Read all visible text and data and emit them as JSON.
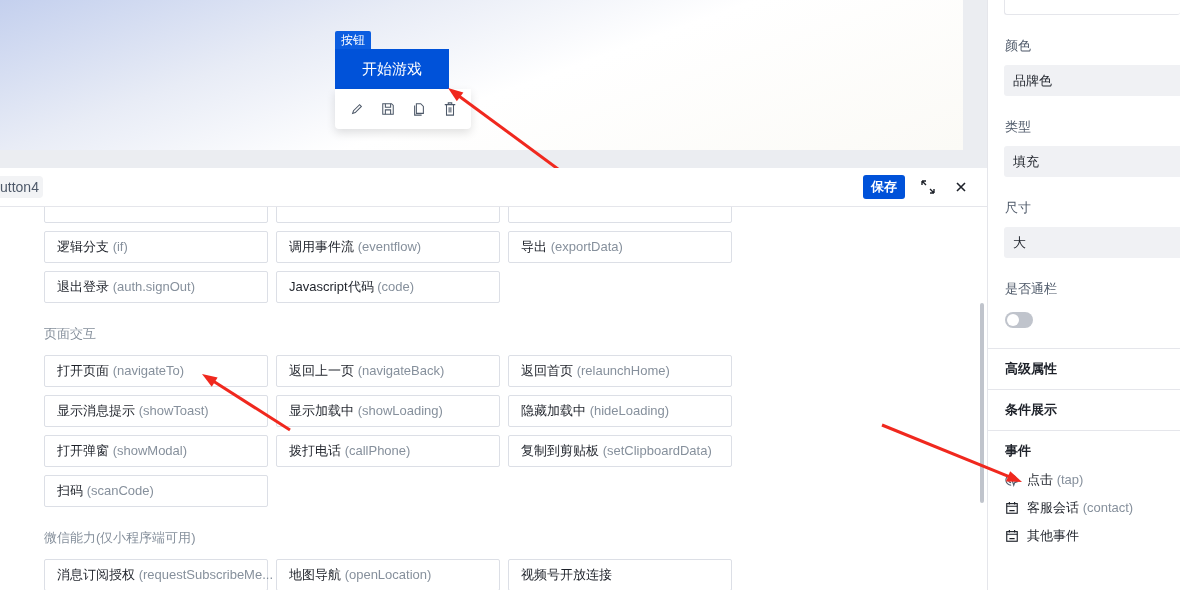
{
  "canvas": {
    "component_tag": "按钮",
    "button_label": "开始游戏"
  },
  "editor": {
    "tag": "utton4",
    "save": "保存",
    "groups": [
      {
        "actions": [
          {
            "name": "逻辑分支",
            "api": "(if)"
          },
          {
            "name": "调用事件流",
            "api": "(eventflow)"
          },
          {
            "name": "导出",
            "api": "(exportData)"
          },
          {
            "name": "退出登录",
            "api": "(auth.signOut)"
          },
          {
            "name": "Javascript代码",
            "api": "(code)"
          }
        ]
      },
      {
        "title": "页面交互",
        "actions": [
          {
            "name": "打开页面",
            "api": "(navigateTo)"
          },
          {
            "name": "返回上一页",
            "api": "(navigateBack)"
          },
          {
            "name": "返回首页",
            "api": "(relaunchHome)"
          },
          {
            "name": "显示消息提示",
            "api": "(showToast)"
          },
          {
            "name": "显示加载中",
            "api": "(showLoading)"
          },
          {
            "name": "隐藏加载中",
            "api": "(hideLoading)"
          },
          {
            "name": "打开弹窗",
            "api": "(showModal)"
          },
          {
            "name": "拨打电话",
            "api": "(callPhone)"
          },
          {
            "name": "复制到剪贴板",
            "api": "(setClipboardData)"
          },
          {
            "name": "扫码",
            "api": "(scanCode)"
          }
        ]
      },
      {
        "title": "微信能力(仅小程序端可用)",
        "actions": [
          {
            "name": "消息订阅授权",
            "api": "(requestSubscribeMe..."
          },
          {
            "name": "地图导航",
            "api": "(openLocation)"
          },
          {
            "name": "视频号开放连接"
          }
        ]
      }
    ]
  },
  "properties": {
    "fields": [
      {
        "label": "颜色",
        "value": "品牌色"
      },
      {
        "label": "类型",
        "value": "填充"
      },
      {
        "label": "尺寸",
        "value": "大"
      }
    ],
    "toggle": {
      "label": "是否通栏",
      "on": false
    },
    "sections": [
      "高级属性",
      "条件展示"
    ],
    "events_title": "事件",
    "events": [
      {
        "kind": "tap",
        "label": "点击",
        "api": "(tap)"
      },
      {
        "kind": "calendar",
        "label": "客服会话",
        "api": "(contact)"
      },
      {
        "kind": "calendar",
        "label": "其他事件"
      }
    ]
  }
}
